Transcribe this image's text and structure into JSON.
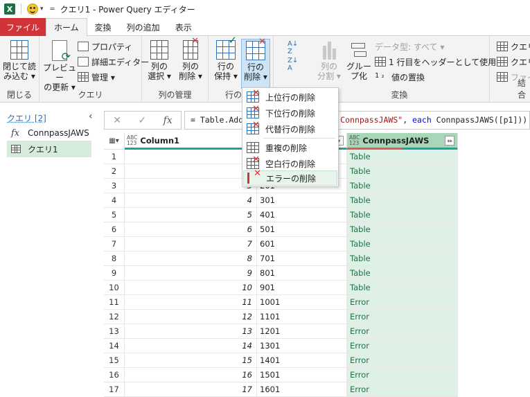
{
  "window": {
    "title": "クエリ1 - Power Query エディター",
    "app_icon": "X"
  },
  "tabs": [
    "ファイル",
    "ホーム",
    "変換",
    "列の追加",
    "表示"
  ],
  "ribbon": {
    "close_load_line1": "閉じて読",
    "close_load_line2": "み込む ▾",
    "close_group": "閉じる",
    "refresh_line1": "プレビュー",
    "refresh_line2": "の更新 ▾",
    "properties": "プロパティ",
    "advanced_editor": "詳細エディター",
    "manage": "管理 ▾",
    "query_group": "クエリ",
    "choose_cols_line1": "列の",
    "choose_cols_line2": "選択 ▾",
    "remove_cols_line1": "列の",
    "remove_cols_line2": "削除 ▾",
    "manage_cols_group": "列の管理",
    "keep_rows_line1": "行の",
    "keep_rows_line2": "保持 ▾",
    "remove_rows_line1": "行の",
    "remove_rows_line2": "削除 ▾",
    "reduce_rows_group": "行の",
    "split_line1": "列の",
    "split_line2": "分割 ▾",
    "group_by_line1": "グルー",
    "group_by_line2": "プ化",
    "data_type": "データ型: すべて ▾",
    "first_row_header": "1 行目をヘッダーとして使用 ▾",
    "replace_values": "値の置換",
    "transform_group": "変換",
    "combine_group": "結合",
    "query_item_a": "クエリの",
    "query_item_b": "クエリの",
    "file_item": "ファイル"
  },
  "formula": {
    "prefix": "= Table.Add",
    "string_part": "ConnpassJAWS\"",
    "middle": ", ",
    "keyword": "each",
    "suffix": " ConnpassJAWS([p1]))"
  },
  "queries": {
    "header": "クエリ [2]",
    "items": [
      {
        "name": "ConnpassJAWS",
        "icon": "function-icon"
      },
      {
        "name": "クエリ1",
        "icon": "table-icon"
      }
    ]
  },
  "columns": [
    {
      "type": "ABC\n123",
      "name": "Column1"
    },
    {
      "type": "A",
      "name": ""
    },
    {
      "type": "ABC\n123",
      "name": "ConnpassJAWS"
    }
  ],
  "rows": [
    {
      "n": "1",
      "c1": "1",
      "c2": "1",
      "c3": "Table"
    },
    {
      "n": "2",
      "c1": "2",
      "c2": "1",
      "c3": "Table"
    },
    {
      "n": "3",
      "c1": "3",
      "c2": "201",
      "c3": "Table"
    },
    {
      "n": "4",
      "c1": "4",
      "c2": "301",
      "c3": "Table"
    },
    {
      "n": "5",
      "c1": "5",
      "c2": "401",
      "c3": "Table"
    },
    {
      "n": "6",
      "c1": "6",
      "c2": "501",
      "c3": "Table"
    },
    {
      "n": "7",
      "c1": "7",
      "c2": "601",
      "c3": "Table"
    },
    {
      "n": "8",
      "c1": "8",
      "c2": "701",
      "c3": "Table"
    },
    {
      "n": "9",
      "c1": "9",
      "c2": "801",
      "c3": "Table"
    },
    {
      "n": "10",
      "c1": "10",
      "c2": "901",
      "c3": "Table"
    },
    {
      "n": "11",
      "c1": "11",
      "c2": "1001",
      "c3": "Error"
    },
    {
      "n": "12",
      "c1": "12",
      "c2": "1101",
      "c3": "Error"
    },
    {
      "n": "13",
      "c1": "13",
      "c2": "1201",
      "c3": "Error"
    },
    {
      "n": "14",
      "c1": "14",
      "c2": "1301",
      "c3": "Error"
    },
    {
      "n": "15",
      "c1": "15",
      "c2": "1401",
      "c3": "Error"
    },
    {
      "n": "16",
      "c1": "16",
      "c2": "1501",
      "c3": "Error"
    },
    {
      "n": "17",
      "c1": "17",
      "c2": "1601",
      "c3": "Error"
    }
  ],
  "menu": {
    "items": [
      "上位行の削除",
      "下位行の削除",
      "代替行の削除",
      "重複の削除",
      "空白行の削除",
      "エラーの削除"
    ]
  },
  "colors": {
    "file_tab": "#d13438",
    "accent_teal": "#1aa3a0",
    "selected_column": "#a8d6b8",
    "selected_query": "#d6eddd",
    "table_text": "#1e7145"
  }
}
